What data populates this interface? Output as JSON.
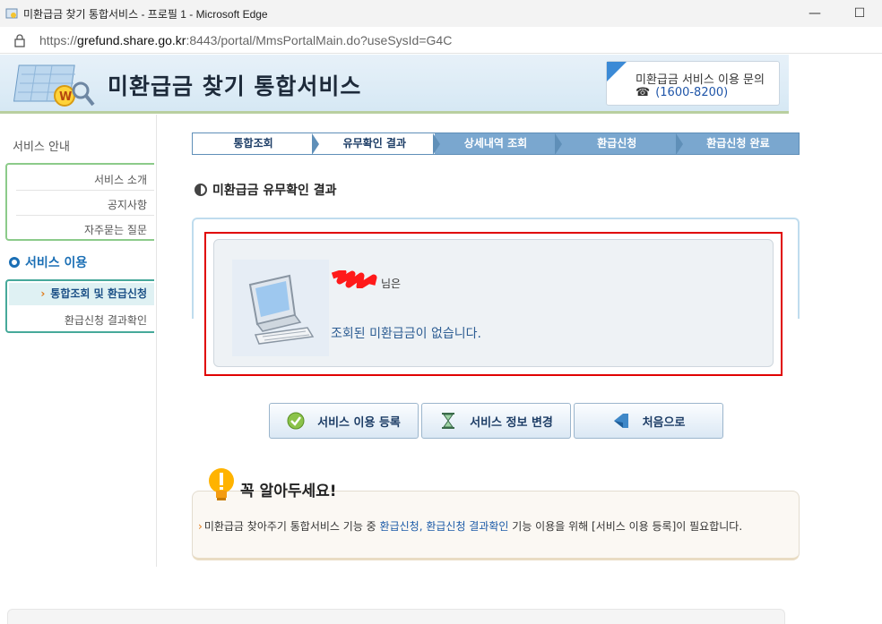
{
  "browser": {
    "window_title": "미환급금 찾기 통합서비스 - 프로필 1 - Microsoft Edge",
    "minimize_glyph": "—",
    "maximize_glyph": "☐",
    "url_prefix": "https://",
    "url_host": "grefund.share.go.kr",
    "url_rest": ":8443/portal/MmsPortalMain.do?useSysId=G4C"
  },
  "header": {
    "site_title": "미환급금 찾기 통합서비스",
    "inquiry_label": "미환급금 서비스 이용 문의",
    "inquiry_phone_icon": "☎",
    "inquiry_phone": "(1600-8200)"
  },
  "sidebar": {
    "section1_title": "서비스 안내",
    "section1_items": [
      "서비스 소개",
      "공지사항",
      "자주묻는 질문"
    ],
    "section2_title": "서비스 이용",
    "section2_active": "통합조회 및 환급신청",
    "section2_items": [
      "환급신청 결과확인"
    ]
  },
  "steps": [
    {
      "label": "통합조회",
      "active": true
    },
    {
      "label": "유무확인 결과",
      "active": true
    },
    {
      "label": "상세내역 조회",
      "active": false
    },
    {
      "label": "환급신청",
      "active": false
    },
    {
      "label": "환급신청 완료",
      "active": false
    }
  ],
  "main": {
    "section_title": "미환급금 유무확인 결과",
    "name_suffix": "님은",
    "result_message": "조회된 미환급금이 없습니다."
  },
  "buttons": {
    "register": "서비스 이용 등록",
    "change_info": "서비스 정보 변경",
    "home": "처음으로"
  },
  "notice": {
    "title": "꼭 알아두세요!",
    "text_before": "미환급금 찾아주기 통합서비스 기능 중 ",
    "highlight": "환급신청, 환급신청 결과확인",
    "text_after": " 기능 이용을 위해 [서비스 이용 등록]이 필요합니다."
  },
  "colors": {
    "accent_blue": "#1b6fb5",
    "step_inactive": "#7aa7cf",
    "result_border": "#e00000"
  }
}
